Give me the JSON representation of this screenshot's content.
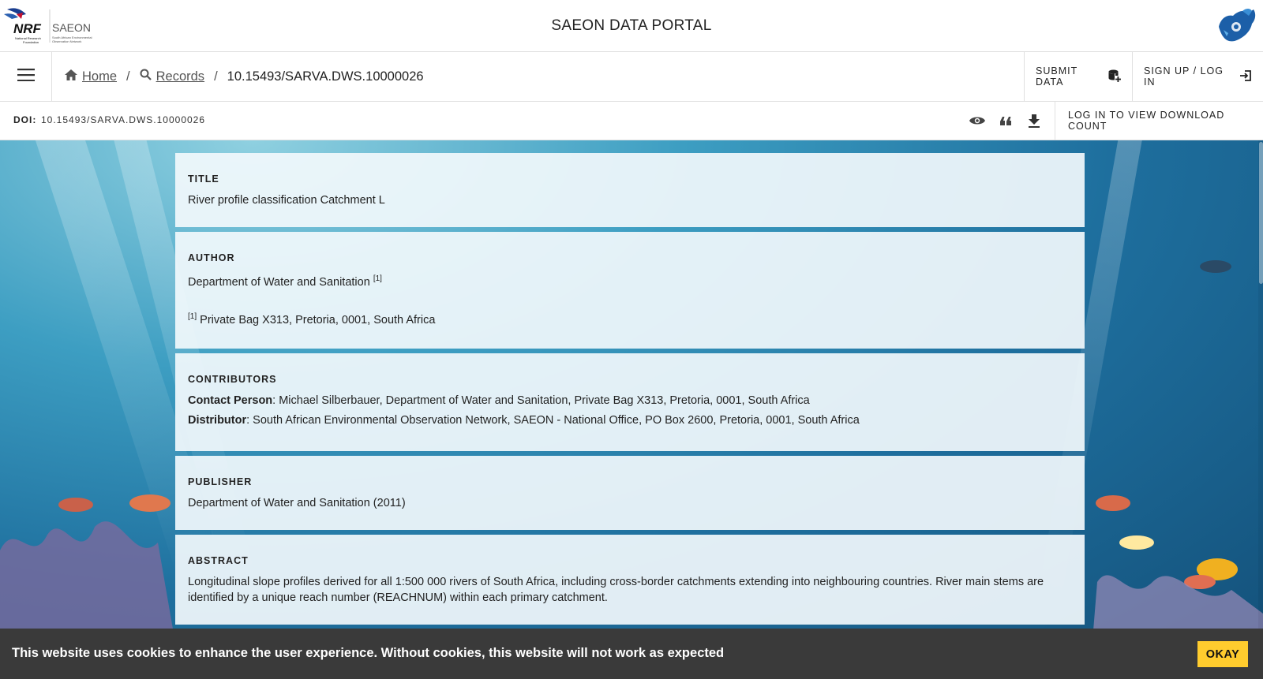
{
  "header": {
    "nrf_logo_text": "NRF",
    "nrf_logo_subtext": "National Research Foundation",
    "saeon_logo_text": "SAEON",
    "saeon_logo_subtext": "South African Environmental Observation Network",
    "portal_title": "SAEON DATA PORTAL"
  },
  "nav": {
    "breadcrumb": {
      "home": "Home",
      "separator": "/",
      "records": "Records",
      "current": "10.15493/SARVA.DWS.10000026"
    },
    "submit_label": "SUBMIT DATA",
    "login_label": "SIGN UP / LOG IN"
  },
  "doi_bar": {
    "label": "DOI:",
    "value": "10.15493/SARVA.DWS.10000026",
    "download_count_label": "LOG IN TO VIEW DOWNLOAD COUNT"
  },
  "record": {
    "title": {
      "heading": "TITLE",
      "text": "River profile classification Catchment L"
    },
    "author": {
      "heading": "AUTHOR",
      "name": "Department of Water and Sanitation",
      "ref_marker": "[1]",
      "affiliation_marker": "[1]",
      "affiliation": "Private Bag X313, Pretoria, 0001, South Africa"
    },
    "contributors": {
      "heading": "CONTRIBUTORS",
      "items": [
        {
          "role": "Contact Person",
          "details": ": Michael Silberbauer, Department of Water and Sanitation, Private Bag X313, Pretoria, 0001, South Africa"
        },
        {
          "role": "Distributor",
          "details": ": South African Environmental Observation Network, SAEON - National Office, PO Box 2600, Pretoria, 0001, South Africa"
        }
      ]
    },
    "publisher": {
      "heading": "PUBLISHER",
      "text": "Department of Water and Sanitation (2011)"
    },
    "abstract": {
      "heading": "ABSTRACT",
      "text": "Longitudinal slope profiles derived for all 1:500 000 rivers of South Africa, including cross-border catchments extending into neighbouring countries. River main stems are identified by a unique reach number (REACHNUM) within each primary catchment."
    }
  },
  "cookie_banner": {
    "text": "This website uses cookies to enhance the user experience. Without cookies, this website will not work as expected",
    "button_label": "OKAY",
    "button_color": "#ffcc2e"
  },
  "icons": [
    "menu-icon",
    "home-icon",
    "search-icon",
    "database-plus-icon",
    "login-icon",
    "eye-icon",
    "quote-icon",
    "download-icon"
  ]
}
